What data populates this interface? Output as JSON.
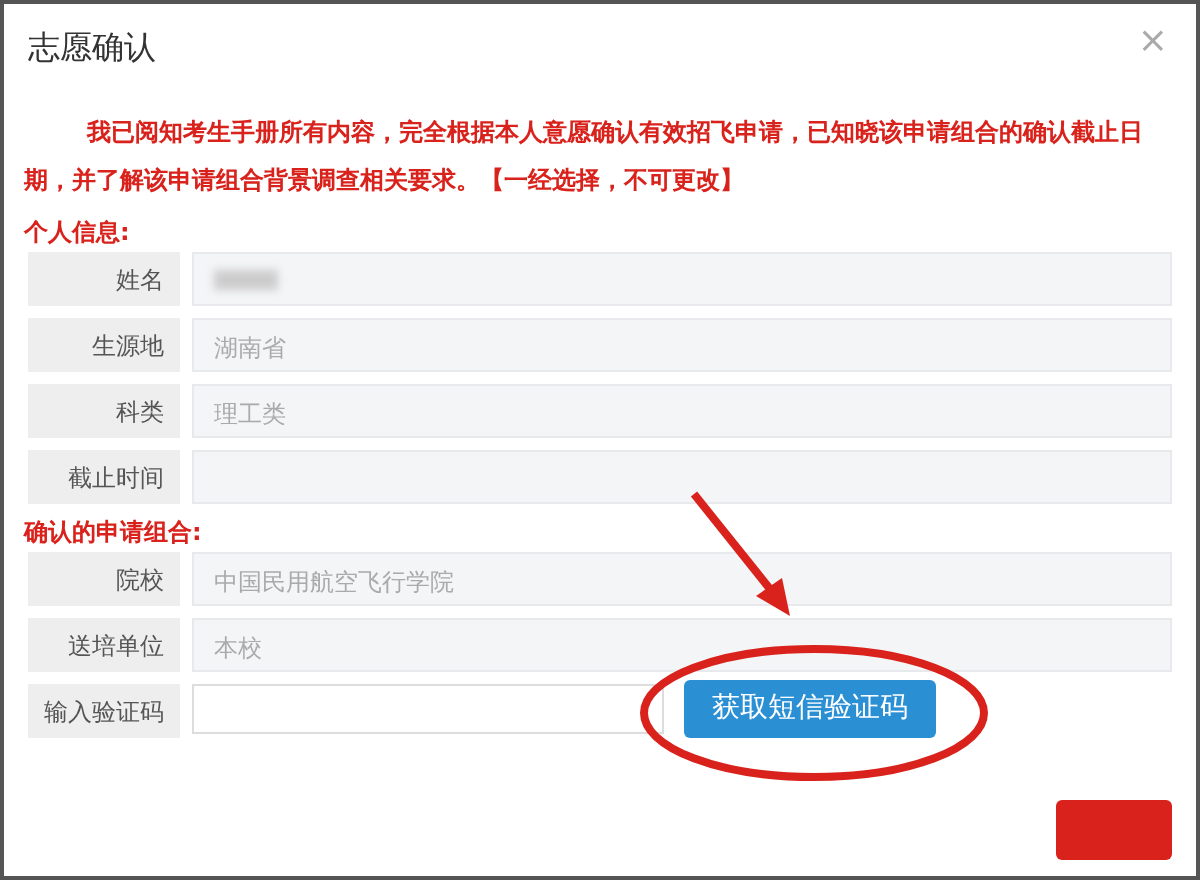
{
  "dialog": {
    "title": "志愿确认",
    "close": "×"
  },
  "notice": "我已阅知考生手册所有内容，完全根据本人意愿确认有效招飞申请，已知晓该申请组合的确认截止日期，并了解该申请组合背景调查相关要求。【一经选择，不可更改】",
  "sections": [
    {
      "heading": "个人信息:",
      "fields": [
        {
          "label": "姓名",
          "kind": "redacted"
        },
        {
          "label": "生源地",
          "kind": "readonly",
          "value": "湖南省"
        },
        {
          "label": "科类",
          "kind": "readonly",
          "value": "理工类"
        },
        {
          "label": "截止时间",
          "kind": "readonly"
        }
      ]
    },
    {
      "heading": "确认的申请组合:",
      "fields": [
        {
          "label": "院校",
          "kind": "readonly",
          "value": "中国民用航空飞行学院"
        },
        {
          "label": "送培单位",
          "kind": "readonly",
          "value": "本校"
        },
        {
          "label": "输入验证码",
          "kind": "input",
          "button": "获取短信验证码"
        }
      ]
    }
  ],
  "annotation": {
    "kind": "circle-arrow"
  },
  "footer": {
    "kind": "danger-button"
  }
}
